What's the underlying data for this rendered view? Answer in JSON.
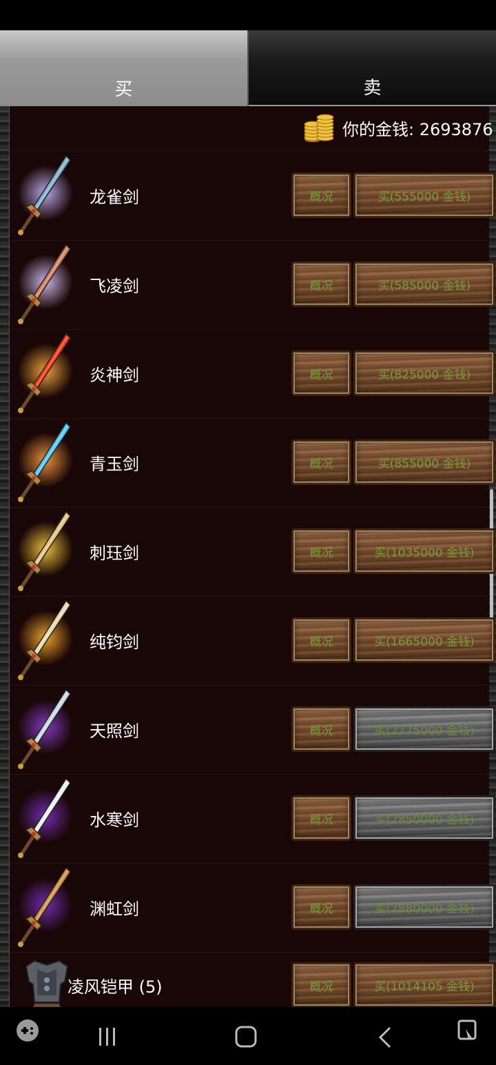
{
  "tabs": {
    "buy": "买",
    "sell": "卖"
  },
  "money": {
    "label": "你的金钱: 2693876"
  },
  "items": [
    {
      "name": "龙雀剑",
      "info": "概况",
      "buy": "买(555000 金钱)",
      "affordable": true,
      "blade": "#7fb0c8",
      "glow": "#c9b8ff"
    },
    {
      "name": "飞凌剑",
      "info": "概况",
      "buy": "买(585000 金钱)",
      "affordable": true,
      "blade": "#d08060",
      "glow": "#d9c8ff"
    },
    {
      "name": "炎神剑",
      "info": "概况",
      "buy": "买(825000 金钱)",
      "affordable": true,
      "blade": "#ff3a1a",
      "glow": "#ffb040"
    },
    {
      "name": "青玉剑",
      "info": "概况",
      "buy": "买(855000 金钱)",
      "affordable": true,
      "blade": "#4fc8ff",
      "glow": "#ffa040"
    },
    {
      "name": "刺珏剑",
      "info": "概况",
      "buy": "买(1035000 金钱)",
      "affordable": true,
      "blade": "#e8c080",
      "glow": "#ffd040"
    },
    {
      "name": "纯钧剑",
      "info": "概况",
      "buy": "买(1665000 金钱)",
      "affordable": true,
      "blade": "#e8d8b0",
      "glow": "#ffb030"
    },
    {
      "name": "天照剑",
      "info": "概况",
      "buy": "买(2775000 金钱)",
      "affordable": false,
      "blade": "#c8d8e0",
      "glow": "#8a40d0"
    },
    {
      "name": "水寒剑",
      "info": "概况",
      "buy": "买(2850000 金钱)",
      "affordable": false,
      "blade": "#e8f0f0",
      "glow": "#7a30c0"
    },
    {
      "name": "渊虹剑",
      "info": "概况",
      "buy": "买(2880000 金钱)",
      "affordable": false,
      "blade": "#d09040",
      "glow": "#7a30c0"
    }
  ],
  "armor": {
    "name": "凌风铠甲 (5)",
    "info": "概况",
    "buy": "买(1014105 金钱)"
  }
}
